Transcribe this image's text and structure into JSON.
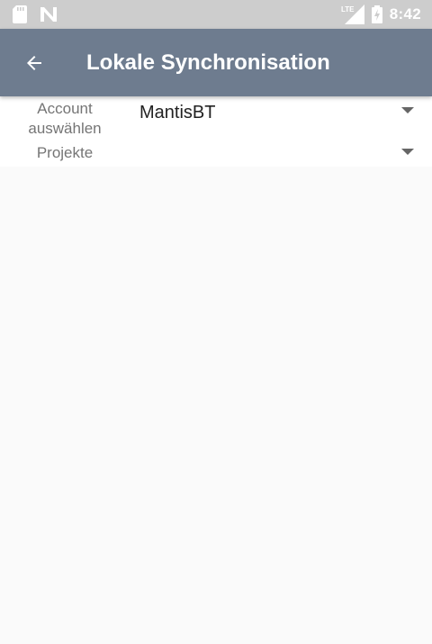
{
  "status_bar": {
    "time": "8:42",
    "network_label": "LTE",
    "icons": [
      "sd-card-icon",
      "n-notification-icon",
      "lte-signal-icon",
      "battery-charging-icon"
    ]
  },
  "app_bar": {
    "title": "Lokale Synchronisation",
    "back_icon": "arrow-back-icon",
    "background": "#6e7c8f"
  },
  "form": {
    "account": {
      "label": "Account auswählen",
      "value": "MantisBT"
    },
    "projects": {
      "label": "Projekte",
      "value": ""
    }
  }
}
